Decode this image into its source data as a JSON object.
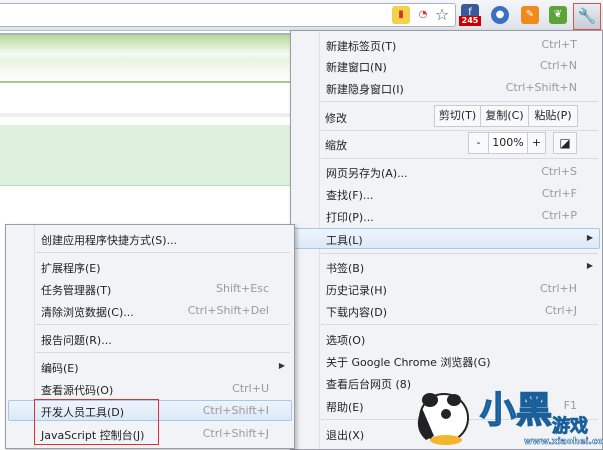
{
  "toolbar": {
    "extension_badge": "245",
    "icons": [
      "bookmark-flag-icon",
      "page-action-icon",
      "star-icon",
      "facebook-extension-icon",
      "extension-icon",
      "rss-icon",
      "evernote-icon",
      "wrench-icon"
    ]
  },
  "main_menu": {
    "new_tab": {
      "label": "新建标签页(T)",
      "shortcut": "Ctrl+T"
    },
    "new_window": {
      "label": "新建窗口(N)",
      "shortcut": "Ctrl+N"
    },
    "incognito": {
      "label": "新建隐身窗口(I)",
      "shortcut": "Ctrl+Shift+N"
    },
    "edit": {
      "label": "修改",
      "cut": "剪切(T)",
      "copy": "复制(C)",
      "paste": "粘贴(P)"
    },
    "zoom": {
      "label": "缩放",
      "minus": "-",
      "value": "100%",
      "plus": "+"
    },
    "save_as": {
      "label": "网页另存为(A)...",
      "shortcut": "Ctrl+S"
    },
    "find": {
      "label": "查找(F)...",
      "shortcut": "Ctrl+F"
    },
    "print": {
      "label": "打印(P)...",
      "shortcut": "Ctrl+P"
    },
    "tools": {
      "label": "工具(L)"
    },
    "bookmarks": {
      "label": "书签(B)"
    },
    "history": {
      "label": "历史记录(H)",
      "shortcut": "Ctrl+H"
    },
    "downloads": {
      "label": "下载内容(D)",
      "shortcut": "Ctrl+J"
    },
    "options": {
      "label": "选项(O)"
    },
    "about": {
      "label": "关于 Google Chrome 浏览器(G)"
    },
    "background": {
      "label": "查看后台网页 (8)"
    },
    "help": {
      "label": "帮助(E)",
      "shortcut": "F1"
    },
    "exit": {
      "label": "退出(X)"
    }
  },
  "tools_menu": {
    "create_shortcut": {
      "label": "创建应用程序快捷方式(S)..."
    },
    "extensions": {
      "label": "扩展程序(E)"
    },
    "task_manager": {
      "label": "任务管理器(T)",
      "shortcut": "Shift+Esc"
    },
    "clear_data": {
      "label": "清除浏览数据(C)...",
      "shortcut": "Ctrl+Shift+Del"
    },
    "report": {
      "label": "报告问题(R)..."
    },
    "encoding": {
      "label": "编码(E)"
    },
    "view_source": {
      "label": "查看源代码(O)",
      "shortcut": "Ctrl+U"
    },
    "dev_tools": {
      "label": "开发人员工具(D)",
      "shortcut": "Ctrl+Shift+I"
    },
    "js_console": {
      "label": "JavaScript 控制台(J)",
      "shortcut": "Ctrl+Shift+J"
    }
  },
  "watermark": {
    "title": "小黑游戏",
    "url": "www.xiaohei.com"
  },
  "colors": {
    "highlight": "#dce9f7",
    "annotation_red": "#e03030",
    "menu_bg": "#f1f3f6"
  }
}
